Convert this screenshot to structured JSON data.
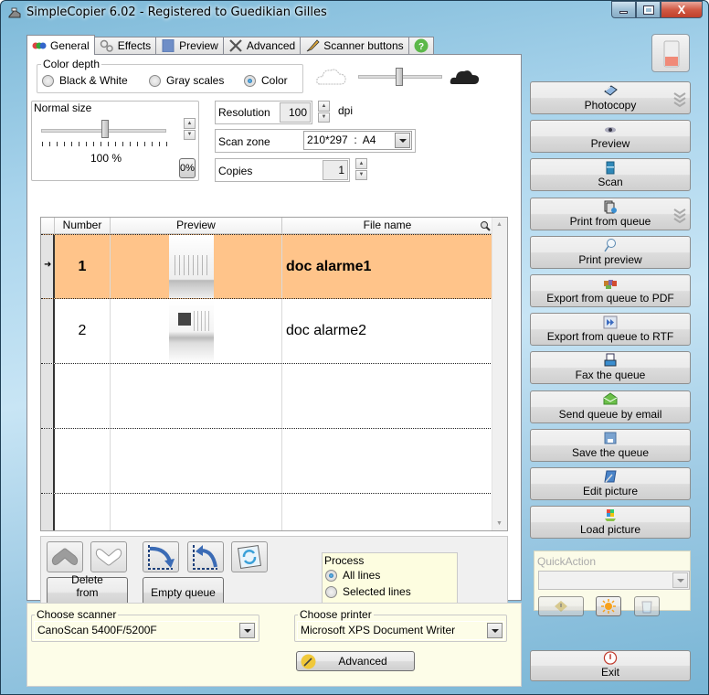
{
  "window": {
    "title": "SimpleCopier 6.02 - Registered to Guedikian Gilles",
    "controls": {
      "minimize": "minimize",
      "maximize": "maximize",
      "close": "close"
    }
  },
  "tabs": [
    {
      "label": "General",
      "icon": "color-balls-icon",
      "active": true
    },
    {
      "label": "Effects",
      "icon": "gears-icon",
      "active": false
    },
    {
      "label": "Preview",
      "icon": "preview-page-icon",
      "active": false
    },
    {
      "label": "Advanced",
      "icon": "tools-icon",
      "active": false
    },
    {
      "label": "Scanner buttons",
      "icon": "pen-icon",
      "active": false
    },
    {
      "label": "",
      "icon": "help-icon",
      "active": false
    }
  ],
  "color_depth": {
    "legend": "Color depth",
    "options": [
      "Black & White",
      "Gray scales",
      "Color"
    ],
    "selected": "Color",
    "brightness_slider": 0.5
  },
  "size": {
    "legend": "Normal size",
    "value_label": "100 %",
    "slider_fraction": 0.5,
    "reset_label": "0%"
  },
  "resolution": {
    "label": "Resolution",
    "value": "100",
    "unit": "dpi"
  },
  "scan_zone": {
    "label": "Scan zone",
    "value": "210*297  :  A4"
  },
  "copies": {
    "label": "Copies",
    "value": "1"
  },
  "grid": {
    "columns": [
      "Number",
      "Preview",
      "File name"
    ],
    "rows": [
      {
        "number": "1",
        "file": "doc alarme1",
        "selected": true
      },
      {
        "number": "2",
        "file": "doc alarme2",
        "selected": false
      },
      {
        "number": "",
        "file": "",
        "selected": false
      },
      {
        "number": "",
        "file": "",
        "selected": false
      },
      {
        "number": "",
        "file": "",
        "selected": false
      }
    ]
  },
  "queue_actions": {
    "delete": "Delete from queue",
    "empty": "Empty queue"
  },
  "process": {
    "legend": "Process",
    "options": [
      "All lines",
      "Selected lines"
    ],
    "selected": "All lines"
  },
  "scanner": {
    "legend": "Choose scanner",
    "value": "CanoScan 5400F/5200F"
  },
  "printer": {
    "legend": "Choose printer",
    "value": "Microsoft XPS Document Writer",
    "advanced": "Advanced"
  },
  "actions": [
    {
      "label": "Photocopy",
      "icon": "scanner-icon",
      "has_menu": true
    },
    {
      "label": "Preview",
      "icon": "eye-icon",
      "has_menu": false
    },
    {
      "label": "Scan",
      "icon": "scan-icon",
      "has_menu": false
    },
    {
      "label": "Print from queue",
      "icon": "print-queue-icon",
      "has_menu": true
    },
    {
      "label": "Print preview",
      "icon": "magnifier-icon",
      "has_menu": false
    },
    {
      "label": "Export from queue to PDF",
      "icon": "pdf-export-icon",
      "has_menu": false
    },
    {
      "label": "Export from queue to RTF",
      "icon": "rtf-export-icon",
      "has_menu": false
    },
    {
      "label": "Fax the queue",
      "icon": "fax-icon",
      "has_menu": false
    },
    {
      "label": "Send queue by email",
      "icon": "email-icon",
      "has_menu": false
    },
    {
      "label": "Save the queue",
      "icon": "save-icon",
      "has_menu": false
    },
    {
      "label": "Edit picture",
      "icon": "edit-picture-icon",
      "has_menu": false
    },
    {
      "label": "Load picture",
      "icon": "load-picture-icon",
      "has_menu": false
    }
  ],
  "quick_action": {
    "legend": "QuickAction",
    "value": ""
  },
  "exit": {
    "label": "Exit"
  },
  "colors": {
    "selected_row": "#ffc48a",
    "bottom_panel": "#fdfde8"
  }
}
